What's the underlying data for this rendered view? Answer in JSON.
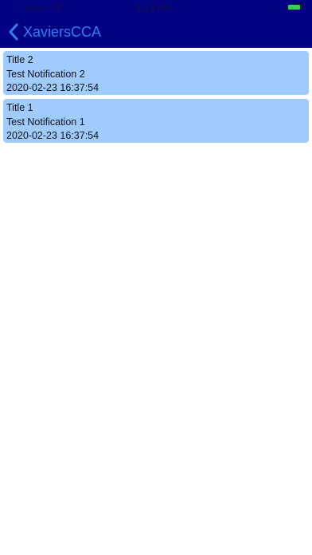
{
  "status_bar": {
    "carrier": "Carrier",
    "time": "8:13 PM"
  },
  "navbar": {
    "back_label": "XaviersCCA"
  },
  "notifications": [
    {
      "title": "Title 2",
      "message": "Test Notification 2",
      "timestamp": "2020-02-23 16:37:54"
    },
    {
      "title": "Title 1",
      "message": "Test Notification 1",
      "timestamp": "2020-02-23 16:37:54"
    }
  ],
  "colors": {
    "nav_background": "#020282",
    "card_background": "#9fcbff",
    "back_text": "#2f7ff6"
  }
}
